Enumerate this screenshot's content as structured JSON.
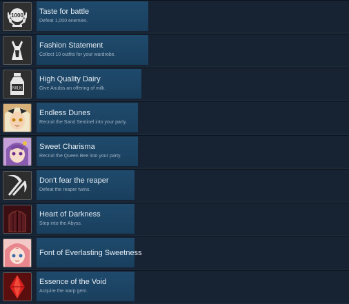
{
  "achievements": [
    {
      "title": "Taste for battle",
      "description": "Defeat 1,000 enemies.",
      "icon": "laurel-1000-icon",
      "icon_text": "1000",
      "progress": 0.32
    },
    {
      "title": "Fashion Statement",
      "description": "Collect 10 outfits for your wardrobe.",
      "icon": "outfit-icon",
      "progress": 0.32
    },
    {
      "title": "High Quality Dairy",
      "description": "Give Anubis an offering of milk.",
      "icon": "milk-bottle-icon",
      "icon_text": "MILK",
      "progress": 0.3
    },
    {
      "title": "Endless Dunes",
      "description": "Recruit the Sand Sentinel into your party.",
      "icon": "sand-sentinel-portrait-icon",
      "progress": 0.29
    },
    {
      "title": "Sweet Charisma",
      "description": "Recruit the Queen Bee into your party.",
      "icon": "queen-bee-portrait-icon",
      "progress": 0.29
    },
    {
      "title": "Don't fear the reaper",
      "description": "Defeat the reaper twins.",
      "icon": "scythes-icon",
      "progress": 0.28
    },
    {
      "title": "Heart of Darkness",
      "description": "Step into the Abyss.",
      "icon": "abyss-door-icon",
      "progress": 0.28
    },
    {
      "title": "Font of Everlasting Sweetness",
      "description": "",
      "icon": "pink-hair-portrait-icon",
      "progress": 0.28
    },
    {
      "title": "Essence of the Void",
      "description": "Acquire the warp gem.",
      "icon": "warp-gem-icon",
      "progress": 0.28
    }
  ],
  "colors": {
    "page_bg": "#1b2838",
    "row_bg": "#172232",
    "progress_bar": "#1f4a6c",
    "title_text": "#e6eef5",
    "description_text": "#9eb1c2"
  }
}
